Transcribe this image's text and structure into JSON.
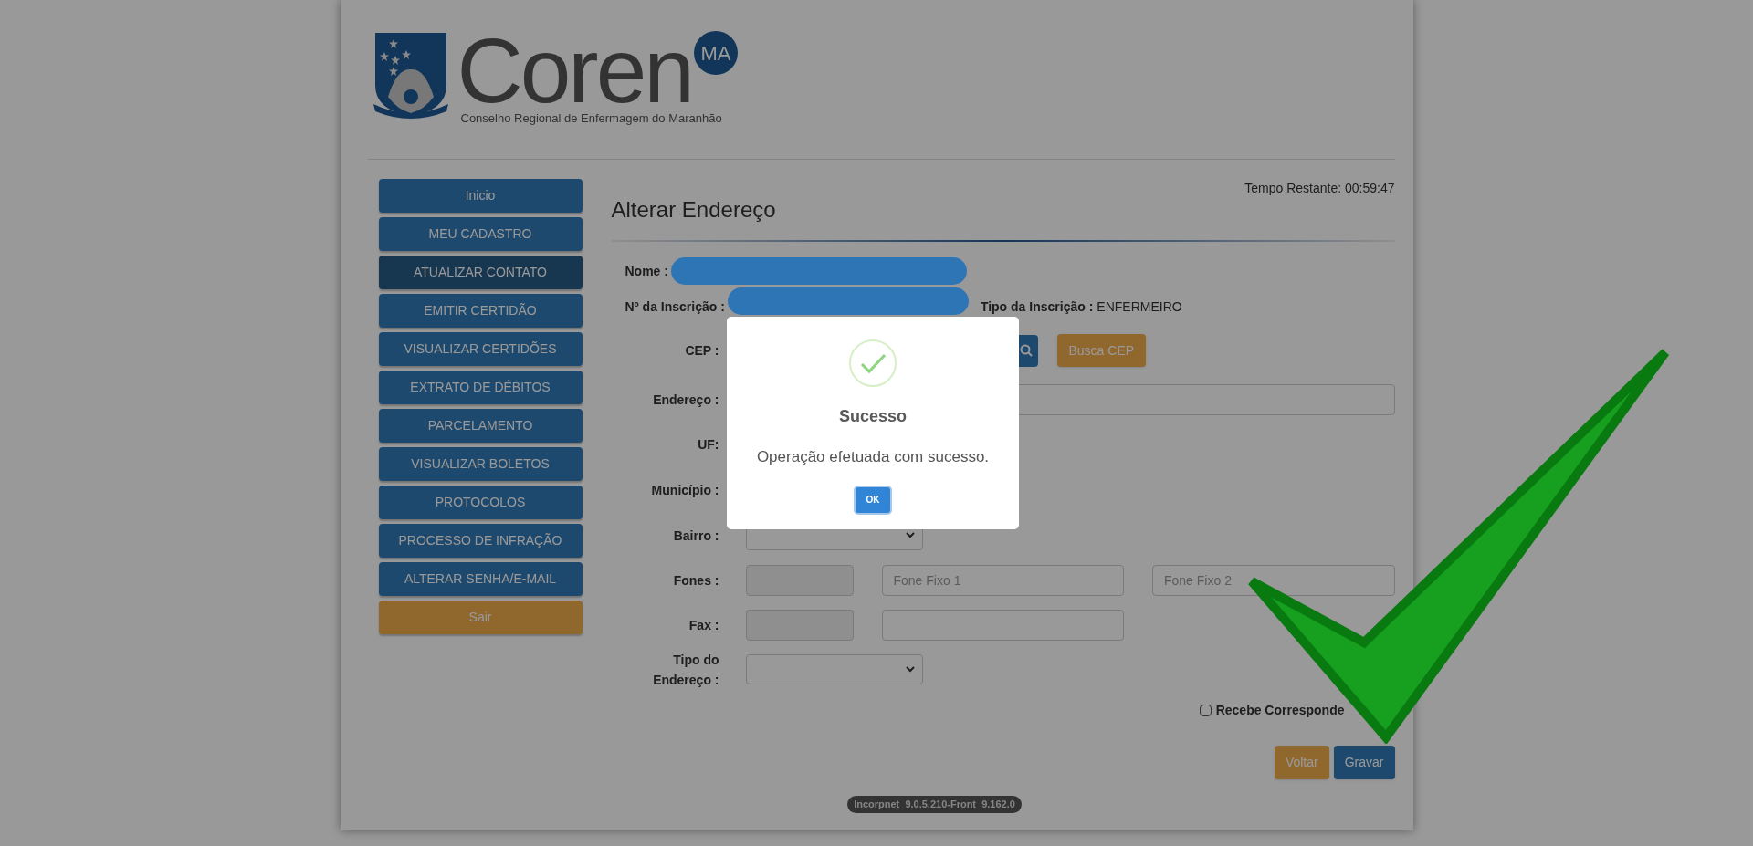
{
  "header": {
    "logo_text": "Coren",
    "logo_badge": "MA",
    "logo_subtitle": "Conselho Regional de Enfermagem do Maranhão"
  },
  "sidebar": {
    "items": [
      {
        "label": "Inicio",
        "kind": "nav",
        "selected": false
      },
      {
        "label": "MEU CADASTRO",
        "kind": "nav",
        "selected": false
      },
      {
        "label": "ATUALIZAR CONTATO",
        "kind": "nav",
        "selected": true
      },
      {
        "label": "EMITIR CERTIDÃO",
        "kind": "nav",
        "selected": false
      },
      {
        "label": "VISUALIZAR CERTIDÕES",
        "kind": "nav",
        "selected": false
      },
      {
        "label": "EXTRATO DE DÉBITOS",
        "kind": "nav",
        "selected": false
      },
      {
        "label": "PARCELAMENTO",
        "kind": "nav",
        "selected": false
      },
      {
        "label": "VISUALIZAR BOLETOS",
        "kind": "nav",
        "selected": false
      },
      {
        "label": "PROTOCOLOS",
        "kind": "nav",
        "selected": false
      },
      {
        "label": "PROCESSO DE INFRAÇÃO",
        "kind": "nav",
        "selected": false
      },
      {
        "label": "ALTERAR SENHA/E-MAIL",
        "kind": "nav",
        "selected": false
      },
      {
        "label": "Sair",
        "kind": "exit",
        "selected": false
      }
    ]
  },
  "timer": "Tempo Restante: 00:59:47",
  "page_title": "Alterar Endereço",
  "form": {
    "rows": [
      {
        "kind": "redacted",
        "label": "Nome :"
      },
      {
        "kind": "redacted_info",
        "label": "Nº da Inscrição :",
        "info_label": "Tipo da Inscrição :",
        "info_value": "ENFERMEIRO"
      },
      {
        "kind": "cep",
        "label": "CEP :",
        "button": "Busca CEP"
      },
      {
        "kind": "text",
        "label": "Endereço :"
      },
      {
        "kind": "label_only",
        "label": "UF:"
      },
      {
        "kind": "label_only",
        "label": "Município :"
      },
      {
        "kind": "select",
        "label": "Bairro :"
      },
      {
        "kind": "phones",
        "label": "Fones :",
        "placeholders": [
          "Fone Fixo 1",
          "Fone Fixo 2"
        ]
      },
      {
        "kind": "fax",
        "label": "Fax :"
      },
      {
        "kind": "select",
        "label": "Tipo do Endereço :"
      }
    ]
  },
  "checkbox": {
    "label": "Recebe Corresponde",
    "checked": false
  },
  "buttons": [
    {
      "label": "Voltar",
      "kind": "secondary"
    },
    {
      "label": "Gravar",
      "kind": "primary"
    }
  ],
  "version": "Incorpnet_9.0.5.210-Front_9.162.0",
  "dialog": {
    "title": "Sucesso",
    "message": "Operação efetuada com sucesso.",
    "button": "OK"
  }
}
